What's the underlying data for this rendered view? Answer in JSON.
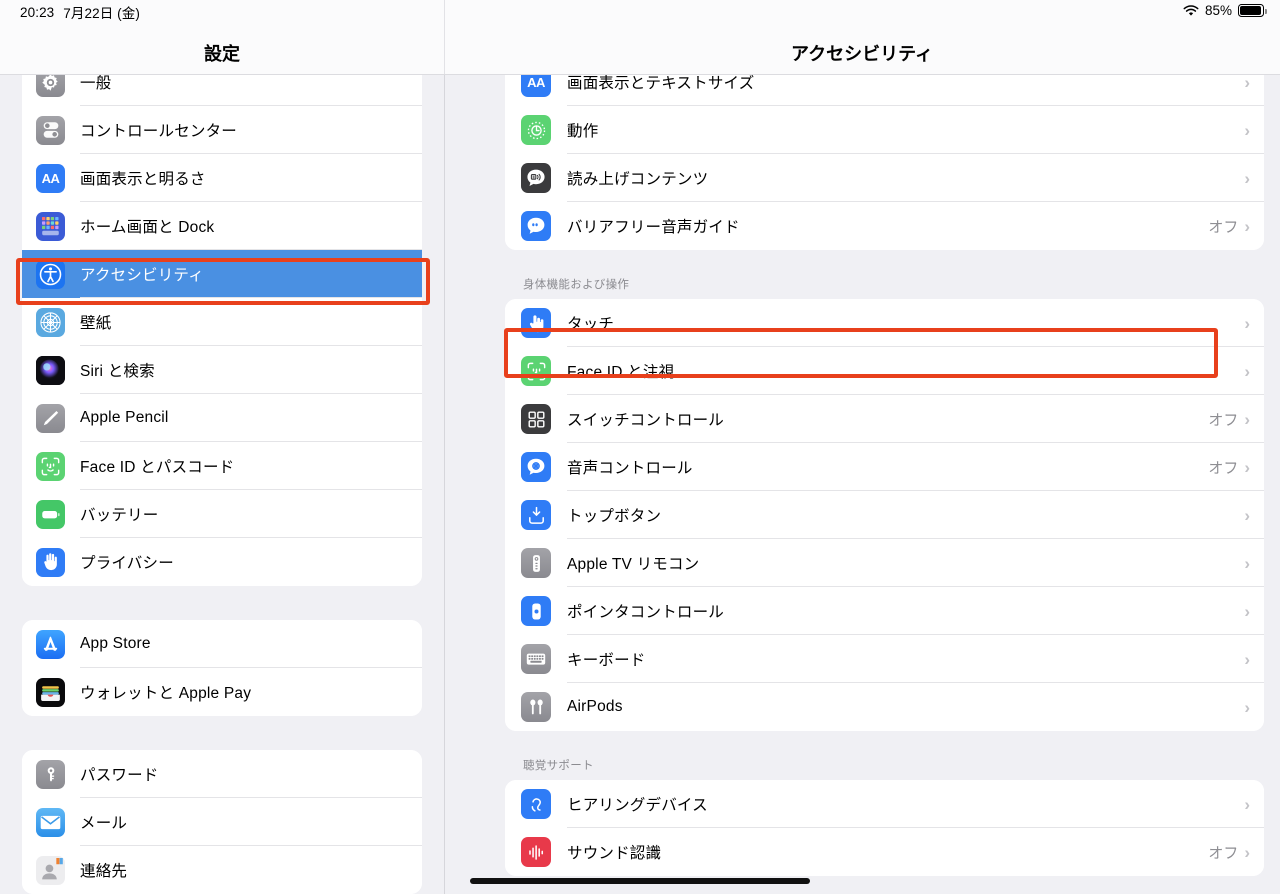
{
  "status_bar": {
    "time": "20:23",
    "date": "7月22日 (金)",
    "battery_percent": "85%",
    "wifi_icon": "wifi-icon",
    "battery_icon": "battery-icon"
  },
  "header": {
    "left_title": "設定",
    "right_title": "アクセシビリティ"
  },
  "colors": {
    "highlight_border": "#e8401c",
    "selected_row": "#4a90e2",
    "panel_background": "#f0f0f4",
    "card_background": "#ffffff",
    "secondary_text": "#8e8e93"
  },
  "sidebar": {
    "groups": [
      {
        "items": [
          {
            "label": "一般",
            "icon": "gear-icon",
            "selected": false
          },
          {
            "label": "コントロールセンター",
            "icon": "control-center-icon",
            "selected": false
          },
          {
            "label": "画面表示と明るさ",
            "icon": "display-brightness-icon",
            "selected": false
          },
          {
            "label": "ホーム画面と Dock",
            "icon": "home-screen-dock-icon",
            "selected": false
          },
          {
            "label": "アクセシビリティ",
            "icon": "accessibility-icon",
            "selected": true
          },
          {
            "label": "壁紙",
            "icon": "wallpaper-icon",
            "selected": false
          },
          {
            "label": "Siri と検索",
            "icon": "siri-icon",
            "selected": false
          },
          {
            "label": "Apple Pencil",
            "icon": "apple-pencil-icon",
            "selected": false
          },
          {
            "label": "Face ID とパスコード",
            "icon": "face-id-icon",
            "selected": false
          },
          {
            "label": "バッテリー",
            "icon": "battery-icon",
            "selected": false
          },
          {
            "label": "プライバシー",
            "icon": "privacy-hand-icon",
            "selected": false
          }
        ]
      },
      {
        "items": [
          {
            "label": "App Store",
            "icon": "app-store-icon",
            "selected": false
          },
          {
            "label": "ウォレットと Apple Pay",
            "icon": "wallet-icon",
            "selected": false
          }
        ]
      },
      {
        "items": [
          {
            "label": "パスワード",
            "icon": "passwords-key-icon",
            "selected": false
          },
          {
            "label": "メール",
            "icon": "mail-icon",
            "selected": false
          },
          {
            "label": "連絡先",
            "icon": "contacts-icon",
            "selected": false
          }
        ]
      }
    ]
  },
  "detail": {
    "groups": [
      {
        "header": "",
        "items": [
          {
            "label": "画面表示とテキストサイズ",
            "icon": "text-size-icon",
            "value": "",
            "highlight": false
          },
          {
            "label": "動作",
            "icon": "motion-icon",
            "value": "",
            "highlight": false
          },
          {
            "label": "読み上げコンテンツ",
            "icon": "spoken-content-icon",
            "value": "",
            "highlight": false
          },
          {
            "label": "バリアフリー音声ガイド",
            "icon": "audio-descriptions-icon",
            "value": "オフ",
            "highlight": false
          }
        ]
      },
      {
        "header": "身体機能および操作",
        "items": [
          {
            "label": "タッチ",
            "icon": "touch-icon",
            "value": "",
            "highlight": true
          },
          {
            "label": "Face ID と注視",
            "icon": "face-id-attention-icon",
            "value": "",
            "highlight": false
          },
          {
            "label": "スイッチコントロール",
            "icon": "switch-control-icon",
            "value": "オフ",
            "highlight": false
          },
          {
            "label": "音声コントロール",
            "icon": "voice-control-icon",
            "value": "オフ",
            "highlight": false
          },
          {
            "label": "トップボタン",
            "icon": "top-button-icon",
            "value": "",
            "highlight": false
          },
          {
            "label": "Apple TV リモコン",
            "icon": "apple-tv-remote-icon",
            "value": "",
            "highlight": false
          },
          {
            "label": "ポインタコントロール",
            "icon": "pointer-control-icon",
            "value": "",
            "highlight": false
          },
          {
            "label": "キーボード",
            "icon": "keyboard-icon",
            "value": "",
            "highlight": false
          },
          {
            "label": "AirPods",
            "icon": "airpods-icon",
            "value": "",
            "highlight": false
          }
        ]
      },
      {
        "header": "聴覚サポート",
        "items": [
          {
            "label": "ヒアリングデバイス",
            "icon": "hearing-devices-icon",
            "value": "",
            "highlight": false
          },
          {
            "label": "サウンド認識",
            "icon": "sound-recognition-icon",
            "value": "オフ",
            "highlight": false
          }
        ]
      }
    ]
  },
  "chevron_glyph": "›"
}
